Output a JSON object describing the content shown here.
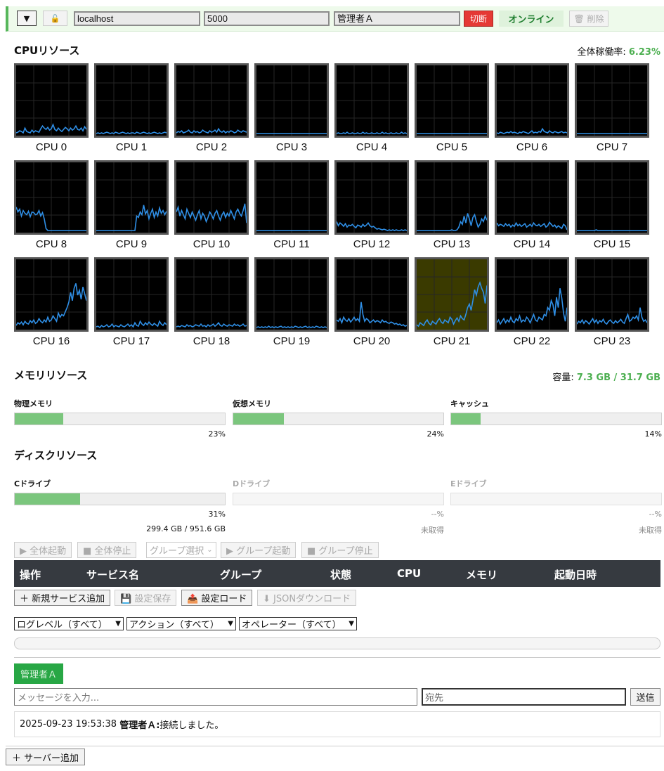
{
  "server": {
    "collapse_icon": "▼",
    "lock_icon": "🔓",
    "host": "localhost",
    "port": "5000",
    "operator": "管理者Ａ",
    "disconnect_label": "切断",
    "status": "オンライン",
    "delete_label": "🗑 削除"
  },
  "cpu": {
    "title": "CPUリソース",
    "overall_label": "全体稼働率:",
    "overall_value": "6.23%",
    "cores": [
      {
        "label": "CPU 0",
        "values": [
          2,
          3,
          5,
          4,
          2,
          9,
          4,
          3,
          2,
          6,
          3,
          5,
          4,
          3,
          8,
          12,
          9,
          7,
          10,
          6,
          8,
          14,
          7,
          5,
          9,
          6,
          4,
          7,
          10,
          8,
          5,
          9,
          6,
          8,
          12,
          7,
          6,
          9,
          5,
          11,
          7
        ]
      },
      {
        "label": "CPU 1",
        "values": [
          1,
          2,
          1,
          2,
          1,
          2,
          3,
          2,
          1,
          2,
          1,
          3,
          2,
          1,
          2,
          3,
          2,
          1,
          2,
          1,
          2,
          2,
          1,
          3,
          2,
          1,
          2,
          3,
          2,
          1,
          2,
          1,
          2,
          3,
          2,
          1,
          2,
          1,
          2,
          3,
          2
        ]
      },
      {
        "label": "CPU 2",
        "values": [
          2,
          4,
          3,
          5,
          2,
          3,
          4,
          6,
          3,
          2,
          5,
          3,
          4,
          2,
          3,
          6,
          4,
          3,
          2,
          5,
          3,
          4,
          6,
          3,
          8,
          4,
          3,
          5,
          2,
          4,
          3,
          5,
          4,
          2,
          3,
          6,
          4,
          3,
          5,
          4,
          3
        ]
      },
      {
        "label": "CPU 3",
        "values": [
          1,
          1,
          1,
          1,
          1,
          1,
          1,
          1,
          1,
          1,
          1,
          1,
          1,
          1,
          1,
          1,
          1,
          1,
          1,
          1,
          1,
          1,
          1,
          1,
          1,
          1,
          1,
          1,
          1,
          1,
          1,
          1,
          1,
          1,
          1,
          1,
          1,
          1,
          1,
          1,
          1
        ]
      },
      {
        "label": "CPU 4",
        "values": [
          1,
          2,
          1,
          1,
          2,
          1,
          3,
          1,
          1,
          2,
          1,
          1,
          2,
          1,
          1,
          3,
          1,
          2,
          1,
          1,
          2,
          1,
          1,
          2,
          1,
          1,
          3,
          1,
          2,
          1,
          1,
          2,
          1,
          1,
          2,
          1,
          1,
          3,
          1,
          2,
          1
        ]
      },
      {
        "label": "CPU 5",
        "values": [
          1,
          1,
          1,
          1,
          1,
          1,
          1,
          1,
          1,
          1,
          1,
          1,
          1,
          1,
          1,
          1,
          1,
          1,
          1,
          1,
          1,
          1,
          1,
          1,
          1,
          1,
          1,
          1,
          1,
          1,
          1,
          1,
          1,
          1,
          1,
          1,
          1,
          1,
          1,
          1,
          1
        ]
      },
      {
        "label": "CPU 6",
        "values": [
          2,
          1,
          3,
          2,
          1,
          2,
          3,
          2,
          4,
          2,
          3,
          2,
          1,
          3,
          2,
          4,
          3,
          2,
          1,
          3,
          5,
          2,
          3,
          2,
          4,
          3,
          8,
          4,
          3,
          2,
          5,
          3,
          2,
          4,
          3,
          2,
          3,
          4,
          2,
          3,
          2
        ]
      },
      {
        "label": "CPU 7",
        "values": [
          1,
          1,
          1,
          1,
          1,
          1,
          1,
          1,
          1,
          1,
          1,
          1,
          1,
          1,
          1,
          1,
          1,
          1,
          1,
          1,
          1,
          1,
          1,
          1,
          1,
          1,
          1,
          1,
          1,
          1,
          1,
          1,
          1,
          1,
          1,
          1,
          1,
          1,
          1,
          1,
          1
        ]
      },
      {
        "label": "CPU 8",
        "values": [
          35,
          28,
          32,
          22,
          30,
          26,
          24,
          29,
          21,
          28,
          27,
          24,
          25,
          30,
          22,
          27,
          18,
          4,
          1,
          1,
          1,
          1,
          1,
          1,
          1,
          1,
          1,
          1,
          1,
          1,
          1,
          1,
          1,
          1,
          1,
          1,
          1,
          1,
          1,
          1,
          1
        ]
      },
      {
        "label": "CPU 9",
        "values": [
          1,
          1,
          1,
          1,
          1,
          1,
          1,
          1,
          1,
          1,
          1,
          1,
          1,
          1,
          1,
          1,
          1,
          1,
          1,
          1,
          1,
          1,
          1,
          22,
          20,
          28,
          24,
          38,
          25,
          30,
          18,
          26,
          32,
          20,
          28,
          22,
          34,
          26,
          30,
          24,
          29
        ]
      },
      {
        "label": "CPU 10",
        "values": [
          28,
          35,
          22,
          30,
          24,
          18,
          32,
          26,
          20,
          28,
          22,
          16,
          24,
          30,
          18,
          26,
          22,
          14,
          20,
          28,
          24,
          18,
          26,
          30,
          22,
          16,
          24,
          28,
          20,
          26,
          22,
          30,
          24,
          18,
          28,
          32,
          26,
          22,
          30,
          40,
          12
        ]
      },
      {
        "label": "CPU 11",
        "values": [
          1,
          1,
          1,
          1,
          1,
          1,
          1,
          1,
          1,
          1,
          1,
          1,
          1,
          1,
          1,
          1,
          1,
          1,
          1,
          1,
          1,
          1,
          1,
          1,
          1,
          1,
          1,
          1,
          1,
          1,
          1,
          1,
          1,
          1,
          1,
          1,
          1,
          1,
          1,
          1,
          1
        ]
      },
      {
        "label": "CPU 12",
        "values": [
          14,
          8,
          12,
          10,
          7,
          11,
          6,
          9,
          8,
          10,
          7,
          5,
          9,
          8,
          6,
          10,
          7,
          9,
          12,
          8,
          6,
          7,
          5,
          3,
          4,
          3,
          2,
          3,
          2,
          1,
          2,
          1,
          2,
          1,
          2,
          1,
          1,
          2,
          1,
          2,
          1
        ]
      },
      {
        "label": "CPU 13",
        "values": [
          1,
          1,
          1,
          1,
          1,
          1,
          1,
          1,
          1,
          1,
          1,
          1,
          1,
          1,
          1,
          1,
          1,
          1,
          1,
          1,
          2,
          1,
          1,
          2,
          6,
          14,
          10,
          22,
          12,
          26,
          18,
          8,
          20,
          24,
          14,
          6,
          10,
          18,
          14,
          22,
          16
        ]
      },
      {
        "label": "CPU 14",
        "values": [
          12,
          8,
          10,
          9,
          7,
          11,
          8,
          10,
          6,
          9,
          7,
          12,
          8,
          10,
          7,
          9,
          11,
          6,
          8,
          10,
          7,
          12,
          9,
          8,
          10,
          7,
          9,
          11,
          6,
          8,
          13,
          10,
          7,
          9,
          5,
          8,
          6,
          4,
          10,
          8,
          2
        ]
      },
      {
        "label": "CPU 15",
        "values": [
          1,
          1,
          1,
          1,
          1,
          1,
          1,
          1,
          1,
          1,
          1,
          2,
          1,
          1,
          1,
          1,
          1,
          1,
          1,
          1,
          1,
          1,
          1,
          1,
          1,
          1,
          1,
          1,
          1,
          1,
          1,
          1,
          1,
          1,
          1,
          1,
          1,
          1,
          1,
          1,
          1
        ]
      },
      {
        "label": "CPU 16",
        "values": [
          4,
          8,
          6,
          9,
          5,
          10,
          7,
          6,
          11,
          8,
          12,
          7,
          9,
          14,
          10,
          8,
          12,
          9,
          16,
          10,
          12,
          18,
          14,
          10,
          22,
          16,
          20,
          18,
          24,
          30,
          38,
          52,
          40,
          58,
          65,
          48,
          55,
          42,
          60,
          50,
          40
        ]
      },
      {
        "label": "CPU 17",
        "values": [
          2,
          3,
          1,
          4,
          2,
          3,
          5,
          2,
          3,
          6,
          2,
          4,
          3,
          2,
          5,
          3,
          2,
          4,
          6,
          3,
          5,
          2,
          8,
          4,
          3,
          10,
          6,
          4,
          8,
          5,
          9,
          6,
          4,
          7,
          5,
          3,
          10,
          6,
          4,
          8,
          5
        ]
      },
      {
        "label": "CPU 18",
        "values": [
          2,
          3,
          2,
          4,
          3,
          2,
          5,
          3,
          4,
          2,
          3,
          5,
          4,
          3,
          6,
          3,
          4,
          2,
          5,
          3,
          4,
          6,
          3,
          5,
          8,
          4,
          3,
          6,
          4,
          3,
          5,
          4,
          3,
          6,
          4,
          5,
          3,
          4,
          6,
          3,
          4
        ]
      },
      {
        "label": "CPU 19",
        "values": [
          1,
          2,
          1,
          2,
          1,
          2,
          1,
          3,
          1,
          2,
          1,
          2,
          1,
          2,
          3,
          1,
          2,
          1,
          2,
          1,
          2,
          1,
          3,
          2,
          1,
          2,
          1,
          2,
          3,
          1,
          2,
          1,
          2,
          1,
          3,
          2,
          1,
          2,
          1,
          2,
          1
        ]
      },
      {
        "label": "CPU 20",
        "values": [
          12,
          10,
          14,
          8,
          16,
          12,
          10,
          14,
          9,
          12,
          16,
          11,
          14,
          10,
          38,
          20,
          10,
          14,
          12,
          8,
          10,
          12,
          9,
          11,
          10,
          8,
          12,
          9,
          10,
          8,
          7,
          9,
          8,
          6,
          7,
          5,
          6,
          4,
          5,
          3,
          4
        ]
      },
      {
        "label": "CPU 21",
        "values": [
          5,
          3,
          8,
          6,
          4,
          9,
          12,
          7,
          5,
          10,
          8,
          6,
          11,
          14,
          9,
          7,
          12,
          10,
          8,
          16,
          13,
          6,
          11,
          15,
          10,
          18,
          14,
          12,
          20,
          30,
          35,
          26,
          40,
          56,
          48,
          60,
          66,
          58,
          52,
          36,
          62
        ]
      },
      {
        "label": "CPU 22",
        "values": [
          8,
          12,
          6,
          10,
          14,
          8,
          12,
          9,
          16,
          10,
          8,
          14,
          11,
          18,
          9,
          12,
          10,
          16,
          13,
          8,
          14,
          20,
          12,
          10,
          16,
          14,
          12,
          20,
          18,
          30,
          26,
          40,
          34,
          18,
          45,
          30,
          58,
          44,
          22,
          10,
          30
        ]
      },
      {
        "label": "CPU 23",
        "values": [
          6,
          10,
          8,
          12,
          7,
          11,
          9,
          6,
          10,
          14,
          8,
          12,
          7,
          11,
          9,
          13,
          8,
          6,
          10,
          12,
          9,
          7,
          11,
          8,
          10,
          13,
          9,
          7,
          14,
          20,
          10,
          12,
          16,
          14,
          18,
          12,
          30,
          16,
          10,
          12,
          8
        ]
      }
    ]
  },
  "memory": {
    "title": "メモリリソース",
    "capacity_label": "容量:",
    "capacity_value": "7.3 GB / 31.7 GB",
    "bars": [
      {
        "label": "物理メモリ",
        "percent_text": "23%",
        "fraction": 0.23
      },
      {
        "label": "仮想メモリ",
        "percent_text": "24%",
        "fraction": 0.24
      },
      {
        "label": "キャッシュ",
        "percent_text": "14%",
        "fraction": 0.14
      }
    ]
  },
  "disk": {
    "title": "ディスクリソース",
    "drives": [
      {
        "label": "Cドライブ",
        "percent_text": "31%",
        "size_text": "299.4 GB / 951.6 GB",
        "fraction": 0.31
      },
      {
        "label": "Dドライブ",
        "percent_text": "--%",
        "size_text": "未取得",
        "fraction": 0
      },
      {
        "label": "Eドライブ",
        "percent_text": "--%",
        "size_text": "未取得",
        "fraction": 0
      }
    ]
  },
  "service_controls": {
    "start_all": "▶ 全体起動",
    "stop_all": "■ 全体停止",
    "group_select": "グループ選択",
    "group_start": "▶ グループ起動",
    "group_stop": "■ グループ停止"
  },
  "service_table": {
    "headers": [
      "操作",
      "サービス名",
      "グループ",
      "状態",
      "CPU",
      "メモリ",
      "起動日時"
    ]
  },
  "service_actions": {
    "add": "＋ 新規サービス追加",
    "save": "💾 設定保存",
    "load": "📤 設定ロード",
    "download": "⬇ JSONダウンロード"
  },
  "log_filters": {
    "level": "ログレベル（すべて）",
    "action": "アクション（すべて）",
    "operator": "オペレーター（すべて）"
  },
  "chat": {
    "user_tab": "管理者Ａ",
    "message_placeholder": "メッセージを入力...",
    "to_placeholder": "宛先",
    "send_label": "送信",
    "log": {
      "timestamp": "2025-09-23 19:53:38",
      "user": "管理者Ａ:",
      "text": " 接続しました。"
    }
  },
  "add_server_label": "＋ サーバー追加",
  "colors": {
    "accent_green": "#4caf50",
    "danger_red": "#e53935",
    "graph_line": "#2f8fe6",
    "highlight": "#3a3a00"
  }
}
